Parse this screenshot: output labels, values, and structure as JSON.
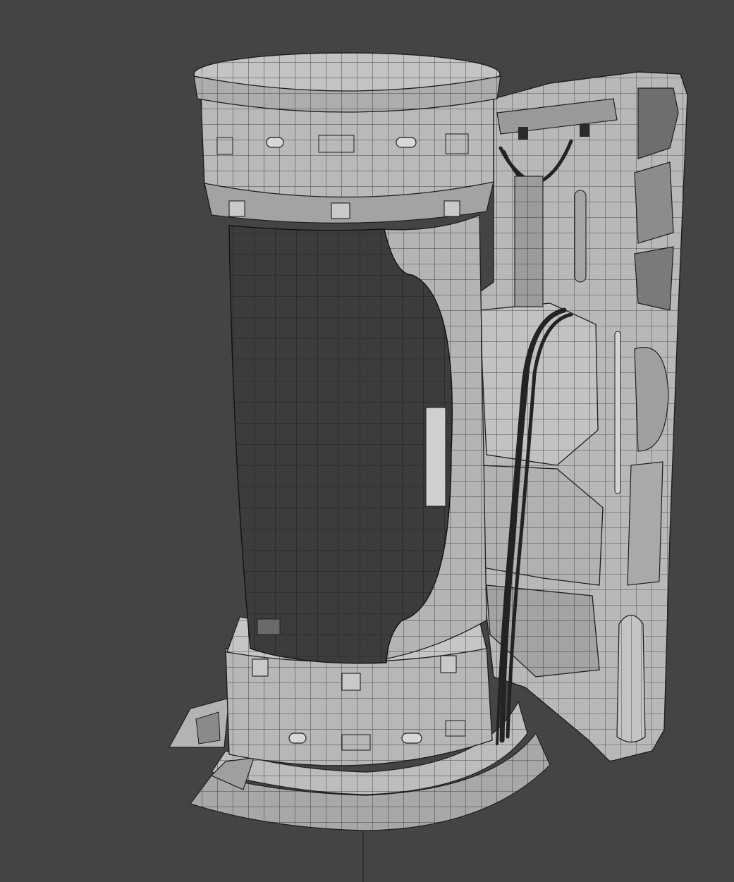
{
  "colors": {
    "background": "#444444",
    "mesh_light": "#b9b9b9",
    "mesh_mid": "#9a9a9a",
    "mesh_shadow": "#7d7d7d",
    "glass": "#3b3b3b",
    "wire": "#1e1e1e",
    "cable": "#262626",
    "panel_slot": "#cfcfcf"
  },
  "viewport": {
    "icon": "3d-viewport-icon",
    "shading": "wireframe-overlay"
  },
  "model": {
    "objects": [
      "cylinder-tank",
      "side-panel",
      "base-platform",
      "cable-bundle",
      "canister"
    ]
  }
}
